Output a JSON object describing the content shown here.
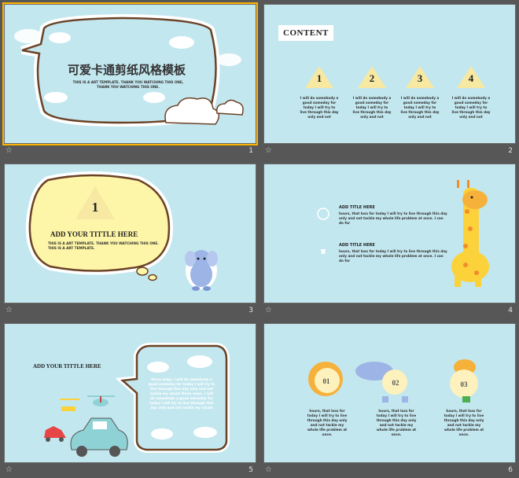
{
  "slides": [
    {
      "num": "1",
      "title": "可爱卡通剪纸风格模板",
      "subtitle": "THIS IS A ART TEMPLATE. THANK YOU WATCHING THIS ONE, THANK YOU WATCHING THIS ONE."
    },
    {
      "num": "2",
      "heading": "CONTENT",
      "items": [
        {
          "n": "1",
          "text": "I will do somebody a good someday for today I will try to live through this day only and not"
        },
        {
          "n": "2",
          "text": "I will do somebody a good someday for today I will try to live through this day only and not"
        },
        {
          "n": "3",
          "text": "I will do somebody a good someday for today I will try to live through this day only and not"
        },
        {
          "n": "4",
          "text": "I will do somebody a good someday for today I will try to live through this day only and not"
        }
      ]
    },
    {
      "num": "3",
      "big_num": "1",
      "title": "ADD YOUR TITTLE HERE",
      "subtitle": "THIS IS A ART TEMPLATE. THANK YOU WATCHING THIS ONE. THIS IS A ART TEMPLATE."
    },
    {
      "num": "4",
      "blocks": [
        {
          "title": "ADD TITLE HERE",
          "text": "hours, that loss for today I will try to live through this day only and not tackle my whole life problem at once. I can do for"
        },
        {
          "title": "ADD TITLE HERE",
          "text": "hours, that loss for today I will try to live through this day only and not tackle my whole life problem at once. I can do for"
        }
      ]
    },
    {
      "num": "5",
      "title": "ADD YOUR TITTLE HERE",
      "text": "three ways. I will do somebody a good someday for today I will try to live through this day only and not tackle my whole three ways. I will do somebody a good someday for today I will try to live through this day only and not tackle my whole"
    },
    {
      "num": "6",
      "items": [
        {
          "n": "01",
          "text": "hours, that loss for today I will try to live through this day only and not tackle my whole life problem at once."
        },
        {
          "n": "02",
          "text": "hours, that loss for today I will try to live through this day only and not tackle my whole life problem at once."
        },
        {
          "n": "03",
          "text": "hours, that loss for today I will try to live through this day only and not tackle my whole life problem at once."
        }
      ]
    }
  ],
  "star_glyph": "☆",
  "colors": {
    "slide_bg": "#c3e7ef",
    "panel_bg": "#575757",
    "selected": "#ffb400",
    "triangle": "#f7e8a2",
    "yellow_bubble": "#fdf5a7"
  }
}
